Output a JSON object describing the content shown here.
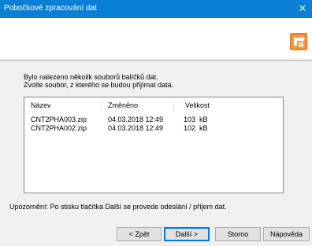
{
  "window": {
    "title": "Pobočkové zpracování dat",
    "close_glyph": "✕"
  },
  "header": {
    "logo_icon": "branch-processing-icon",
    "logo_color": "#f07c2b"
  },
  "message": {
    "line1": "Bylo nalezeno několik souborů balíčků dat.",
    "line2": "Zvolte soubor, z kterého se budou přijímat data."
  },
  "table": {
    "columns": [
      "Název",
      "Změněno",
      "Velikost"
    ],
    "rows": [
      {
        "name": "CNT2PHA003.zip",
        "modified": "04.03.2018 12:49",
        "size": "103  kB"
      },
      {
        "name": "CNT2PHA002.zip",
        "modified": "04.03.2018 12:49",
        "size": "102  kB"
      }
    ]
  },
  "notice": "Upozornění: Po stisku tlačítka Další se provede odeslání / příjem dat.",
  "buttons": {
    "back": "< Zpět",
    "next": "Další >",
    "cancel": "Storno",
    "help": "Nápověda"
  }
}
